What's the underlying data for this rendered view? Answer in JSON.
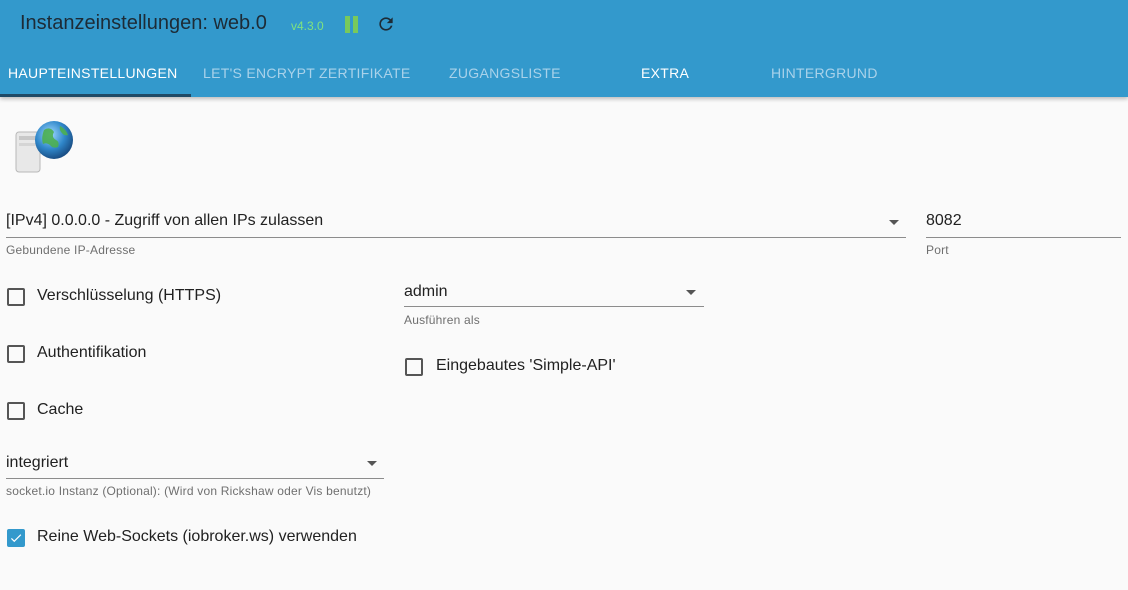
{
  "header": {
    "title": "Instanzeinstellungen: web.0",
    "version": "v4.3.0",
    "pause_icon": "pause-icon",
    "reload_icon": "reload-icon",
    "accent_color": "#3399cc"
  },
  "tabs": [
    {
      "label": "Haupteinstellungen",
      "active": true
    },
    {
      "label": "Let's Encrypt Zertifikate",
      "active": false
    },
    {
      "label": "Zugangsliste",
      "active": false
    },
    {
      "label": "Extra",
      "active": false
    },
    {
      "label": "Hintergrund",
      "active": false
    }
  ],
  "logo": "server-globe-icon",
  "ip_select": {
    "value": "[IPv4] 0.0.0.0 - Zugriff von allen IPs zulassen",
    "label": "Gebundene IP-Adresse"
  },
  "port": {
    "value": "8082",
    "label": "Port"
  },
  "checkboxes": {
    "https": {
      "label": "Verschlüsselung (HTTPS)",
      "checked": false
    },
    "auth": {
      "label": "Authentifikation",
      "checked": false
    },
    "cache": {
      "label": "Cache",
      "checked": false
    },
    "simple_api": {
      "label": "Eingebautes 'Simple-API'",
      "checked": false
    },
    "web_sockets": {
      "label": "Reine Web-Sockets (iobroker.ws) verwenden",
      "checked": true
    }
  },
  "run_as": {
    "value": "admin",
    "label": "Ausführen als"
  },
  "socketio": {
    "value": "integriert",
    "label": "socket.io Instanz (Optional): (Wird von Rickshaw oder Vis benutzt)"
  }
}
